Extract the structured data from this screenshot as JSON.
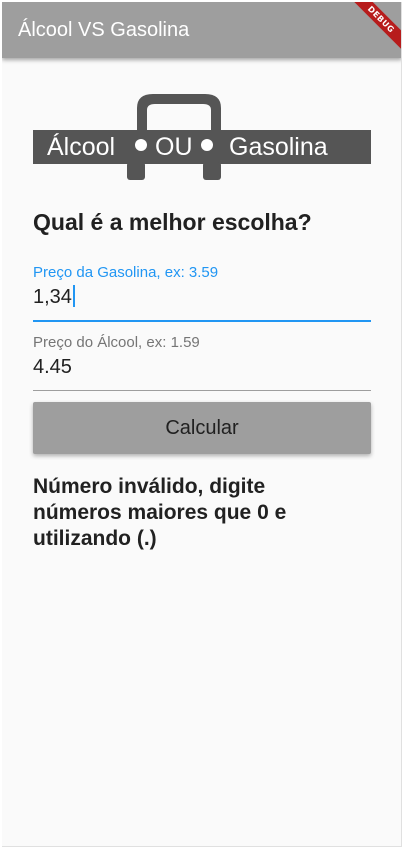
{
  "appbar": {
    "title": "Álcool VS Gasolina",
    "debug_banner": "DEBUG"
  },
  "logo": {
    "word1": "Álcool",
    "word2": "OU",
    "word3": "Gasolina"
  },
  "heading": "Qual é a melhor escolha?",
  "fields": {
    "gasoline": {
      "label": "Preço da Gasolina, ex: 3.59",
      "value": "1,34"
    },
    "alcohol": {
      "label": "Preço do Álcool, ex: 1.59",
      "value": "4.45"
    }
  },
  "button": {
    "label": "Calcular"
  },
  "result": "Número inválido, digite números maiores que 0 e utilizando (.)",
  "colors": {
    "appbar": "#9e9e9e",
    "accent": "#2196f3",
    "logo": "#555555",
    "debug_ribbon": "#b71c1c"
  }
}
